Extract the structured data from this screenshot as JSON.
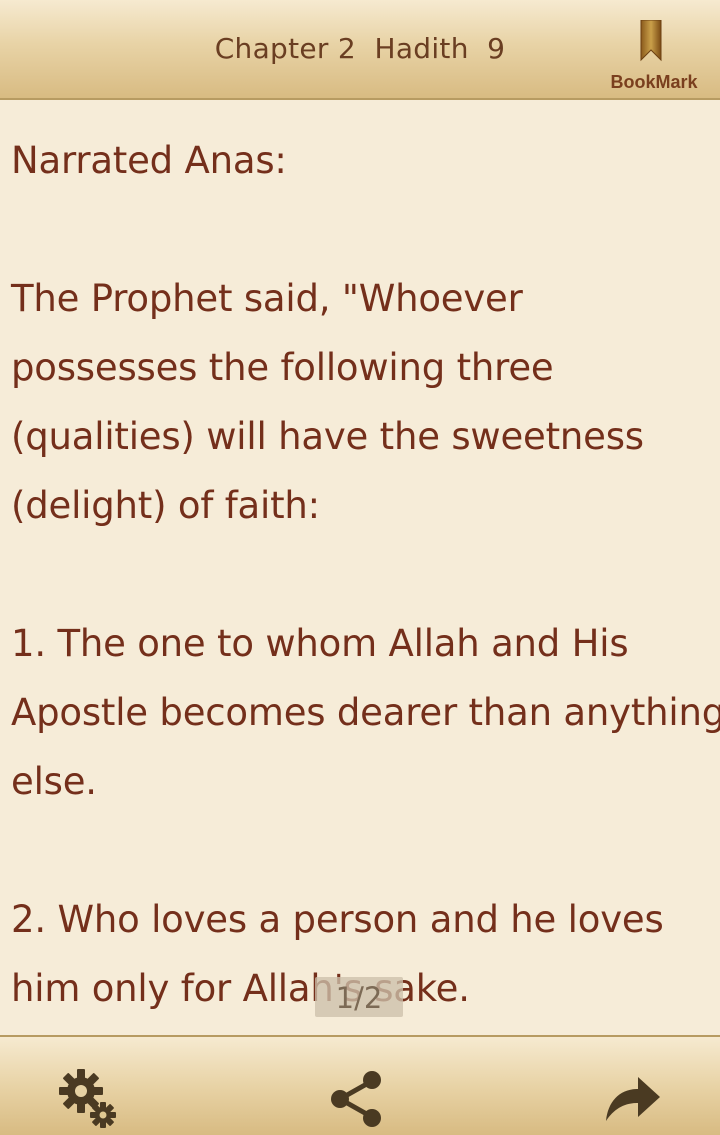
{
  "header": {
    "chapter_label": "Chapter 2",
    "hadith_label": "Hadith",
    "hadith_number": "9",
    "bookmark_label": "BookMark"
  },
  "content": {
    "lines": [
      "Narrated Anas:",
      "",
      "The Prophet said, \"Whoever",
      "possesses the following three",
      "(qualities) will have the sweetness",
      "(delight) of faith:",
      "",
      "1. The one to whom Allah and His",
      "Apostle becomes dearer than anything",
      "else.",
      "",
      "2. Who loves a person and he loves",
      "him only for Allah's sake."
    ]
  },
  "page_indicator": "1/2",
  "footer": {
    "icons": [
      "settings-icon",
      "share-icon",
      "forward-icon"
    ]
  },
  "colors": {
    "text": "#742f1b",
    "header_text": "#6a3e22",
    "background": "#f6ecd8",
    "bar_gradient_top": "#f6ead0",
    "bar_gradient_bottom": "#d8bb82"
  }
}
